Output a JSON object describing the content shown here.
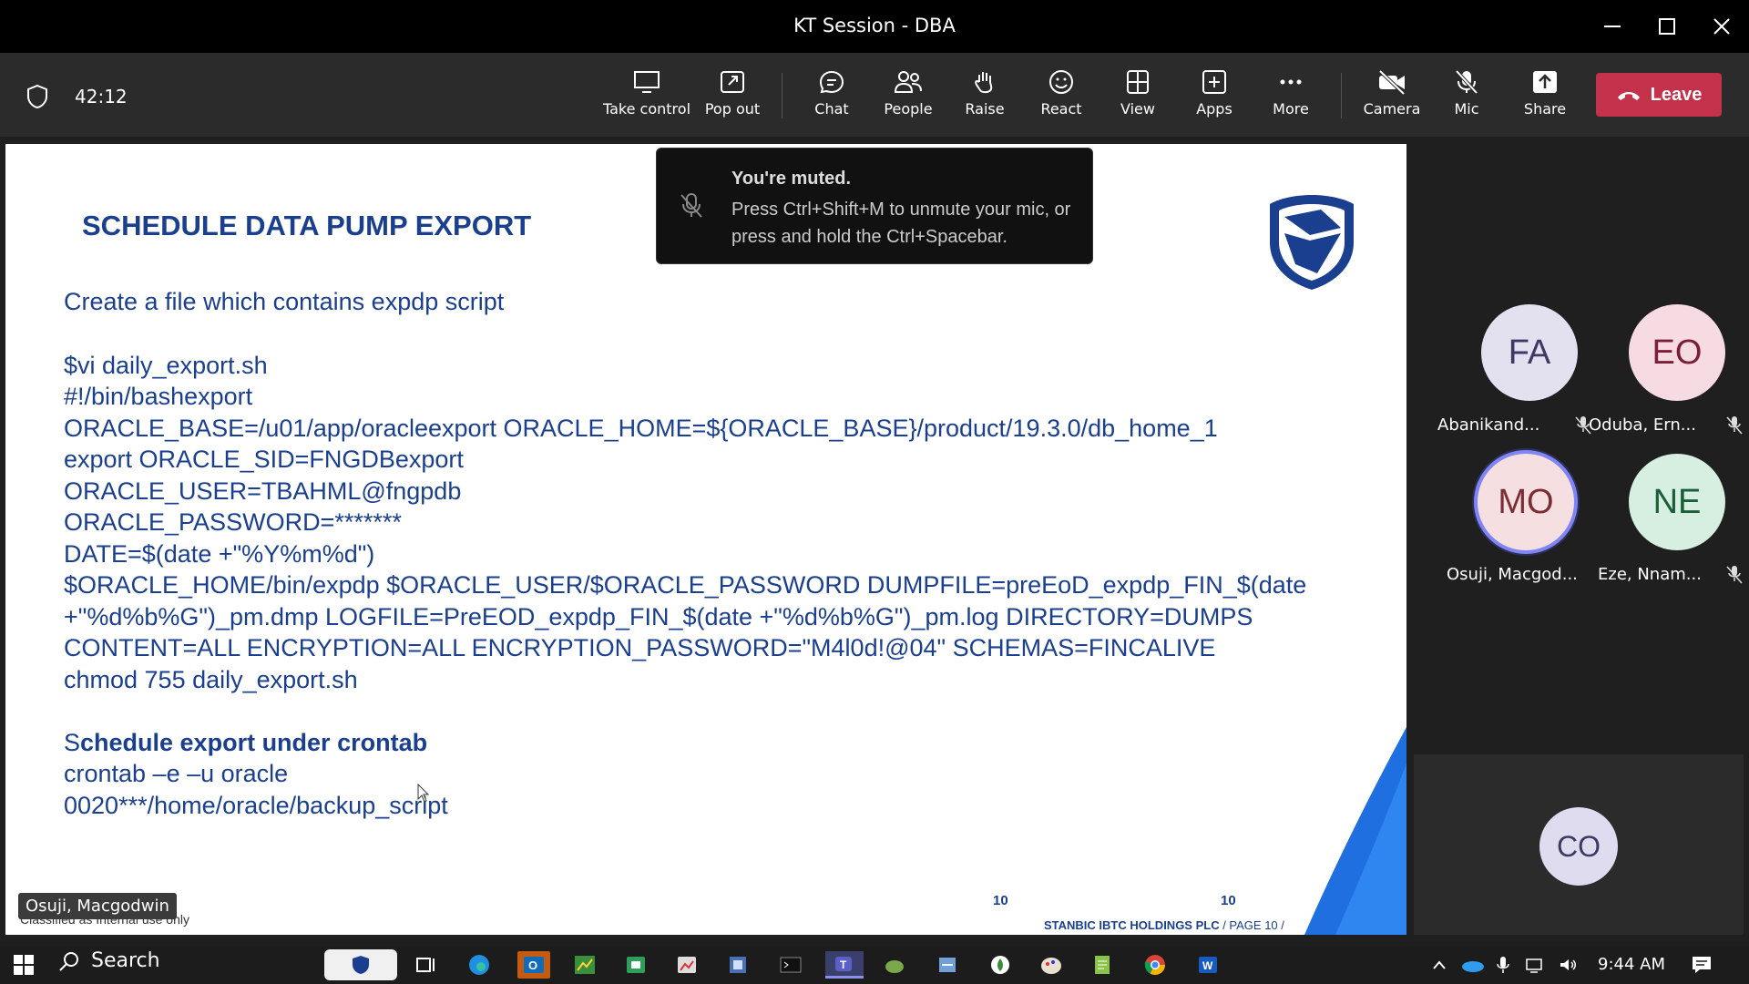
{
  "window": {
    "title": "KT Session - DBA"
  },
  "meeting": {
    "timer": "42:12",
    "toolbar": [
      {
        "label": "Take control",
        "icon": "take-control-icon"
      },
      {
        "label": "Pop out",
        "icon": "pop-out-icon"
      },
      {
        "label": "Chat",
        "icon": "chat-icon"
      },
      {
        "label": "People",
        "icon": "people-icon"
      },
      {
        "label": "Raise",
        "icon": "raise-hand-icon"
      },
      {
        "label": "React",
        "icon": "react-icon"
      },
      {
        "label": "View",
        "icon": "view-icon"
      },
      {
        "label": "Apps",
        "icon": "apps-icon"
      },
      {
        "label": "More",
        "icon": "more-icon"
      },
      {
        "label": "Camera",
        "icon": "camera-off-icon"
      },
      {
        "label": "Mic",
        "icon": "mic-off-icon"
      },
      {
        "label": "Share",
        "icon": "share-icon"
      }
    ],
    "leave_label": "Leave",
    "accent": "#c4314b"
  },
  "toast": {
    "title": "You're muted.",
    "message": "Press Ctrl+Shift+M to unmute your mic, or press and hold the Ctrl+Spacebar."
  },
  "slide": {
    "title": "SCHEDULE DATA PUMP EXPORT",
    "lines": [
      "Create a file which contains expdp script",
      "$vi daily_export.sh",
      "#!/bin/bashexport",
      "ORACLE_BASE=/u01/app/oracleexport ORACLE_HOME=${ORACLE_BASE}/product/19.3.0/db_home_1",
      "export ORACLE_SID=FNGDBexport",
      "ORACLE_USER=TBAHML@fngpdb",
      "ORACLE_PASSWORD=*******",
      "DATE=$(date +\"%Y%m%d\")",
      "$ORACLE_HOME/bin/expdp $ORACLE_USER/$ORACLE_PASSWORD DUMPFILE=preEoD_expdp_FIN_$(date",
      "+\"%d%b%G\")_pm.dmp LOGFILE=PreEOD_expdp_FIN_$(date +\"%d%b%G\")_pm.log DIRECTORY=DUMPS",
      "CONTENT=ALL ENCRYPTION=ALL ENCRYPTION_PASSWORD=\"M4l0d!@04\" SCHEMAS=FINCALIVE",
      "chmod 755 daily_export.sh"
    ],
    "section2_s": "S",
    "section2_rest": "chedule export under crontab",
    "lines2": [
      "crontab –e –u oracle",
      "0020***/home/oracle/backup_script"
    ],
    "footer_num_left": "10",
    "footer_num_right": "10",
    "footer_company": "STANBIC IBTC HOLDINGS PLC",
    "footer_page": " / PAGE 10 /",
    "brand_color": "#1a3f8f"
  },
  "participants": [
    {
      "initials": "FA",
      "name": "Abanikand...",
      "bg": "#e3e0ef",
      "fg": "#3c3a63",
      "muted": true
    },
    {
      "initials": "EO",
      "name": "Oduba, Ern...",
      "bg": "#f7dbe2",
      "fg": "#7a1f36",
      "muted": true
    },
    {
      "initials": "MO",
      "name": "Osuji, Macgod...",
      "bg": "#f5dfe0",
      "fg": "#7a2d34",
      "muted": false,
      "speaking": true
    },
    {
      "initials": "NE",
      "name": "Eze, Nnam...",
      "bg": "#d6efe0",
      "fg": "#1b5e3a",
      "muted": true
    }
  ],
  "self_tile": {
    "initials": "CO"
  },
  "presenter_name": "Osuji, Macgodwin",
  "classification": "Classified as Internal use only",
  "taskbar": {
    "search": "Search",
    "time": "9:44 AM"
  }
}
